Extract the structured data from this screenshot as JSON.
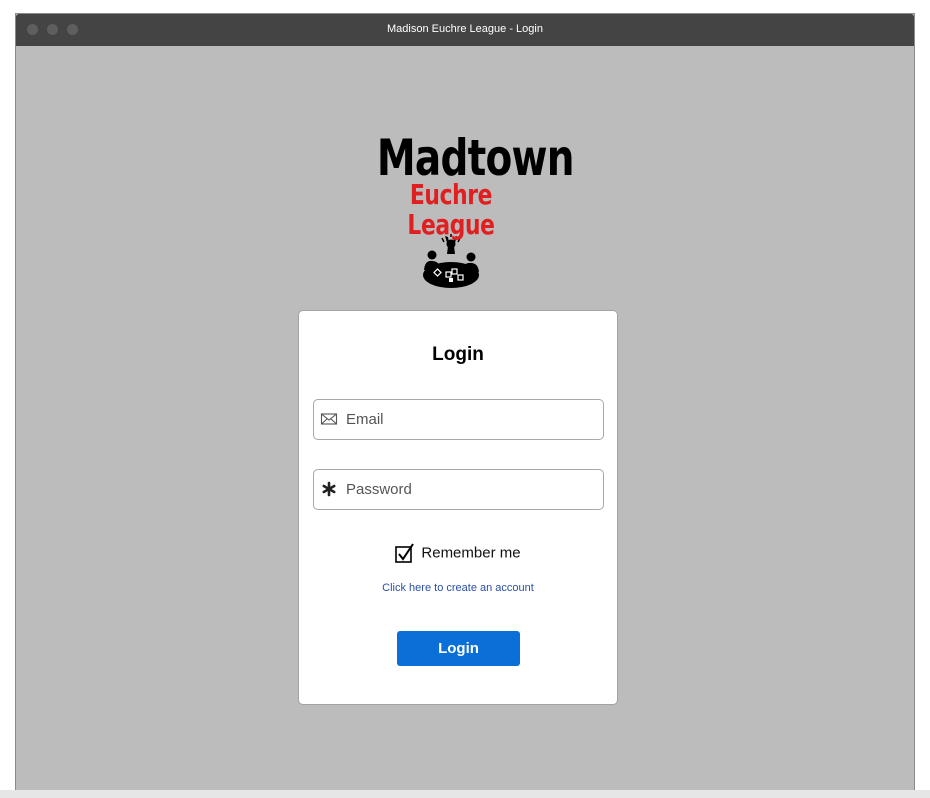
{
  "window": {
    "title": "Madison Euchre League - Login"
  },
  "logo": {
    "line1": "Madtown",
    "line2": "Euchre League",
    "line2_color": "#e02020",
    "icon": "people-around-table-icon"
  },
  "login_form": {
    "title": "Login",
    "email": {
      "placeholder": "Email",
      "value": "",
      "icon": "envelope-icon"
    },
    "password": {
      "placeholder": "Password",
      "value": "",
      "icon": "asterisk-icon"
    },
    "remember_me": {
      "label": "Remember me",
      "checked": true
    },
    "create_account_link": "Click here to create an account",
    "submit_label": "Login",
    "submit_color": "#0a6fd6"
  }
}
